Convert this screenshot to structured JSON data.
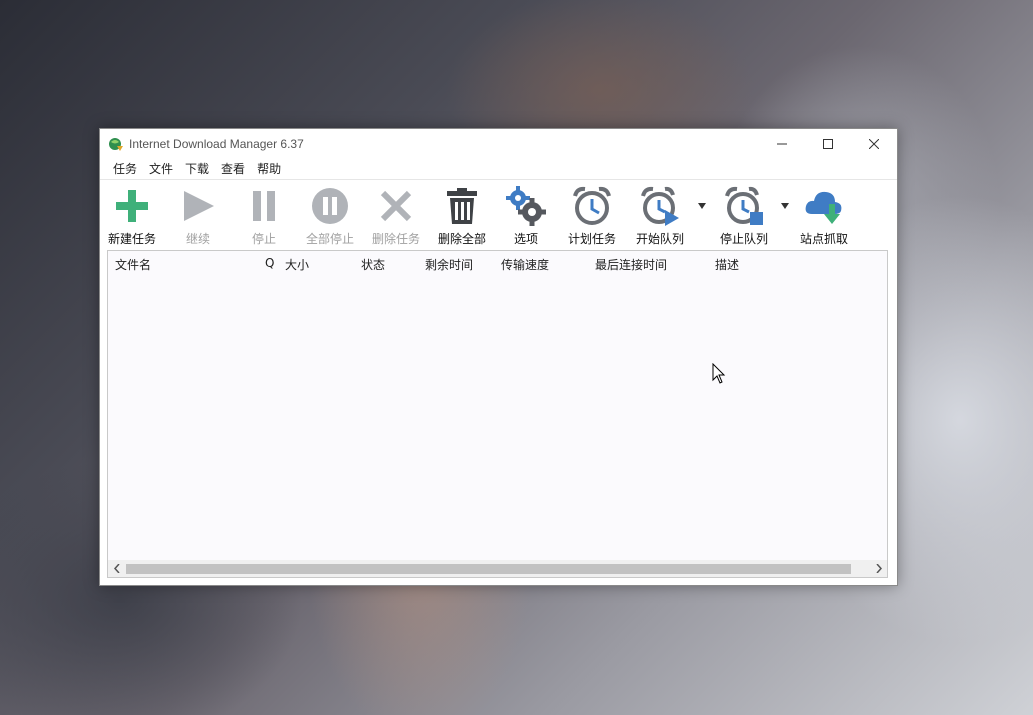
{
  "window": {
    "title": "Internet Download Manager 6.37"
  },
  "menubar": {
    "items": [
      "任务",
      "文件",
      "下载",
      "查看",
      "帮助"
    ]
  },
  "toolbar": {
    "add_task": "新建任务",
    "resume": "继续",
    "stop": "停止",
    "stop_all": "全部停止",
    "delete_task": "删除任务",
    "delete_all": "删除全部",
    "options": "选项",
    "scheduler": "计划任务",
    "start_queue": "开始队列",
    "stop_queue": "停止队列",
    "site_grabber": "站点抓取"
  },
  "list": {
    "columns": [
      "文件名",
      "Q",
      "大小",
      "状态",
      "剩余时间",
      "传输速度",
      "最后连接时间",
      "描述"
    ],
    "rows": []
  },
  "icons": {
    "add": "plus-icon",
    "resume": "play-icon",
    "stop": "pause-icon",
    "stop_all": "pause-circle-icon",
    "delete": "x-icon",
    "delete_all": "trash-icon",
    "options": "gears-icon",
    "scheduler": "alarm-clock-icon",
    "start_queue": "clock-play-icon",
    "stop_queue": "clock-stop-icon",
    "site_grabber": "cloud-download-icon"
  },
  "colors": {
    "accent_green": "#3fb07a",
    "accent_blue": "#3f7cc4",
    "icon_gray": "#6b6f75",
    "disabled_gray": "#b0b3b8"
  }
}
